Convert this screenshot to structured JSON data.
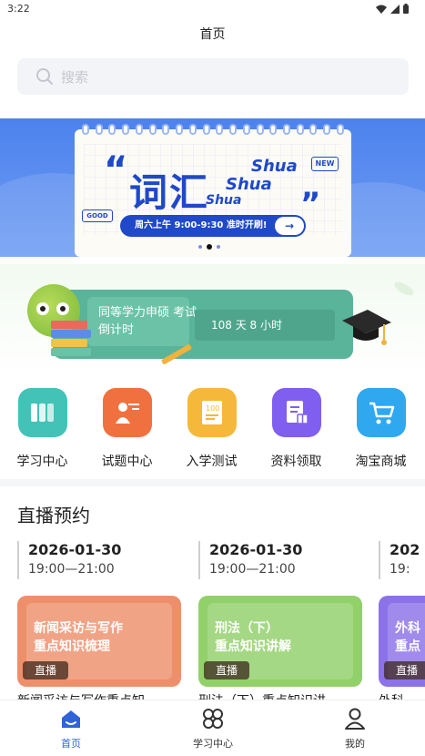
{
  "status": {
    "time": "3:22"
  },
  "header": {
    "title": "首页"
  },
  "search": {
    "placeholder": "搜索"
  },
  "banner": {
    "headline": "词汇",
    "brand_words": [
      "Shua",
      "Shua",
      "Shua"
    ],
    "new_tag": "NEW",
    "good_tag": "GOOD",
    "schedule": "周六上午 9:00-9:30 准时开刷!",
    "arrow": "→",
    "page_count": 3,
    "active_page": 2
  },
  "countdown": {
    "label": "同等学力申硕 考试倒计时",
    "remaining": "108 天 8 小时"
  },
  "quick_menu": [
    {
      "label": "学习中心",
      "icon": "books-icon",
      "color": "#43c3b8"
    },
    {
      "label": "试题中心",
      "icon": "teacher-icon",
      "color": "#f0713f"
    },
    {
      "label": "入学测试",
      "icon": "exam-paper-icon",
      "color": "#f5b83a"
    },
    {
      "label": "资料领取",
      "icon": "document-gift-icon",
      "color": "#7f5ef0"
    },
    {
      "label": "淘宝商城",
      "icon": "shopping-cart-icon",
      "color": "#2fa8ef"
    }
  ],
  "live": {
    "section_title": "直播预约",
    "items": [
      {
        "date": "2026-01-30",
        "time": "19:00—21:00",
        "card_title_1": "新闻采访与写作",
        "card_title_2": "重点知识梳理",
        "tag": "直播",
        "color": "#ee8f6b",
        "subtitle": "新闻采访与写作重点知"
      },
      {
        "date": "2026-01-30",
        "time": "19:00—21:00",
        "card_title_1": "刑法（下）",
        "card_title_2": "重点知识讲解",
        "tag": "直播",
        "color": "#92d06a",
        "subtitle": "刑法（下）重点知识讲"
      },
      {
        "date": "202",
        "time": "19:",
        "card_title_1": "外科",
        "card_title_2": "重点",
        "tag": "直播",
        "color": "#8c72e8",
        "subtitle": "外科"
      }
    ]
  },
  "bottom_nav": [
    {
      "label": "首页",
      "icon": "home-icon",
      "active": true
    },
    {
      "label": "学习中心",
      "icon": "grid-icon",
      "active": false
    },
    {
      "label": "我的",
      "icon": "user-icon",
      "active": false
    }
  ]
}
